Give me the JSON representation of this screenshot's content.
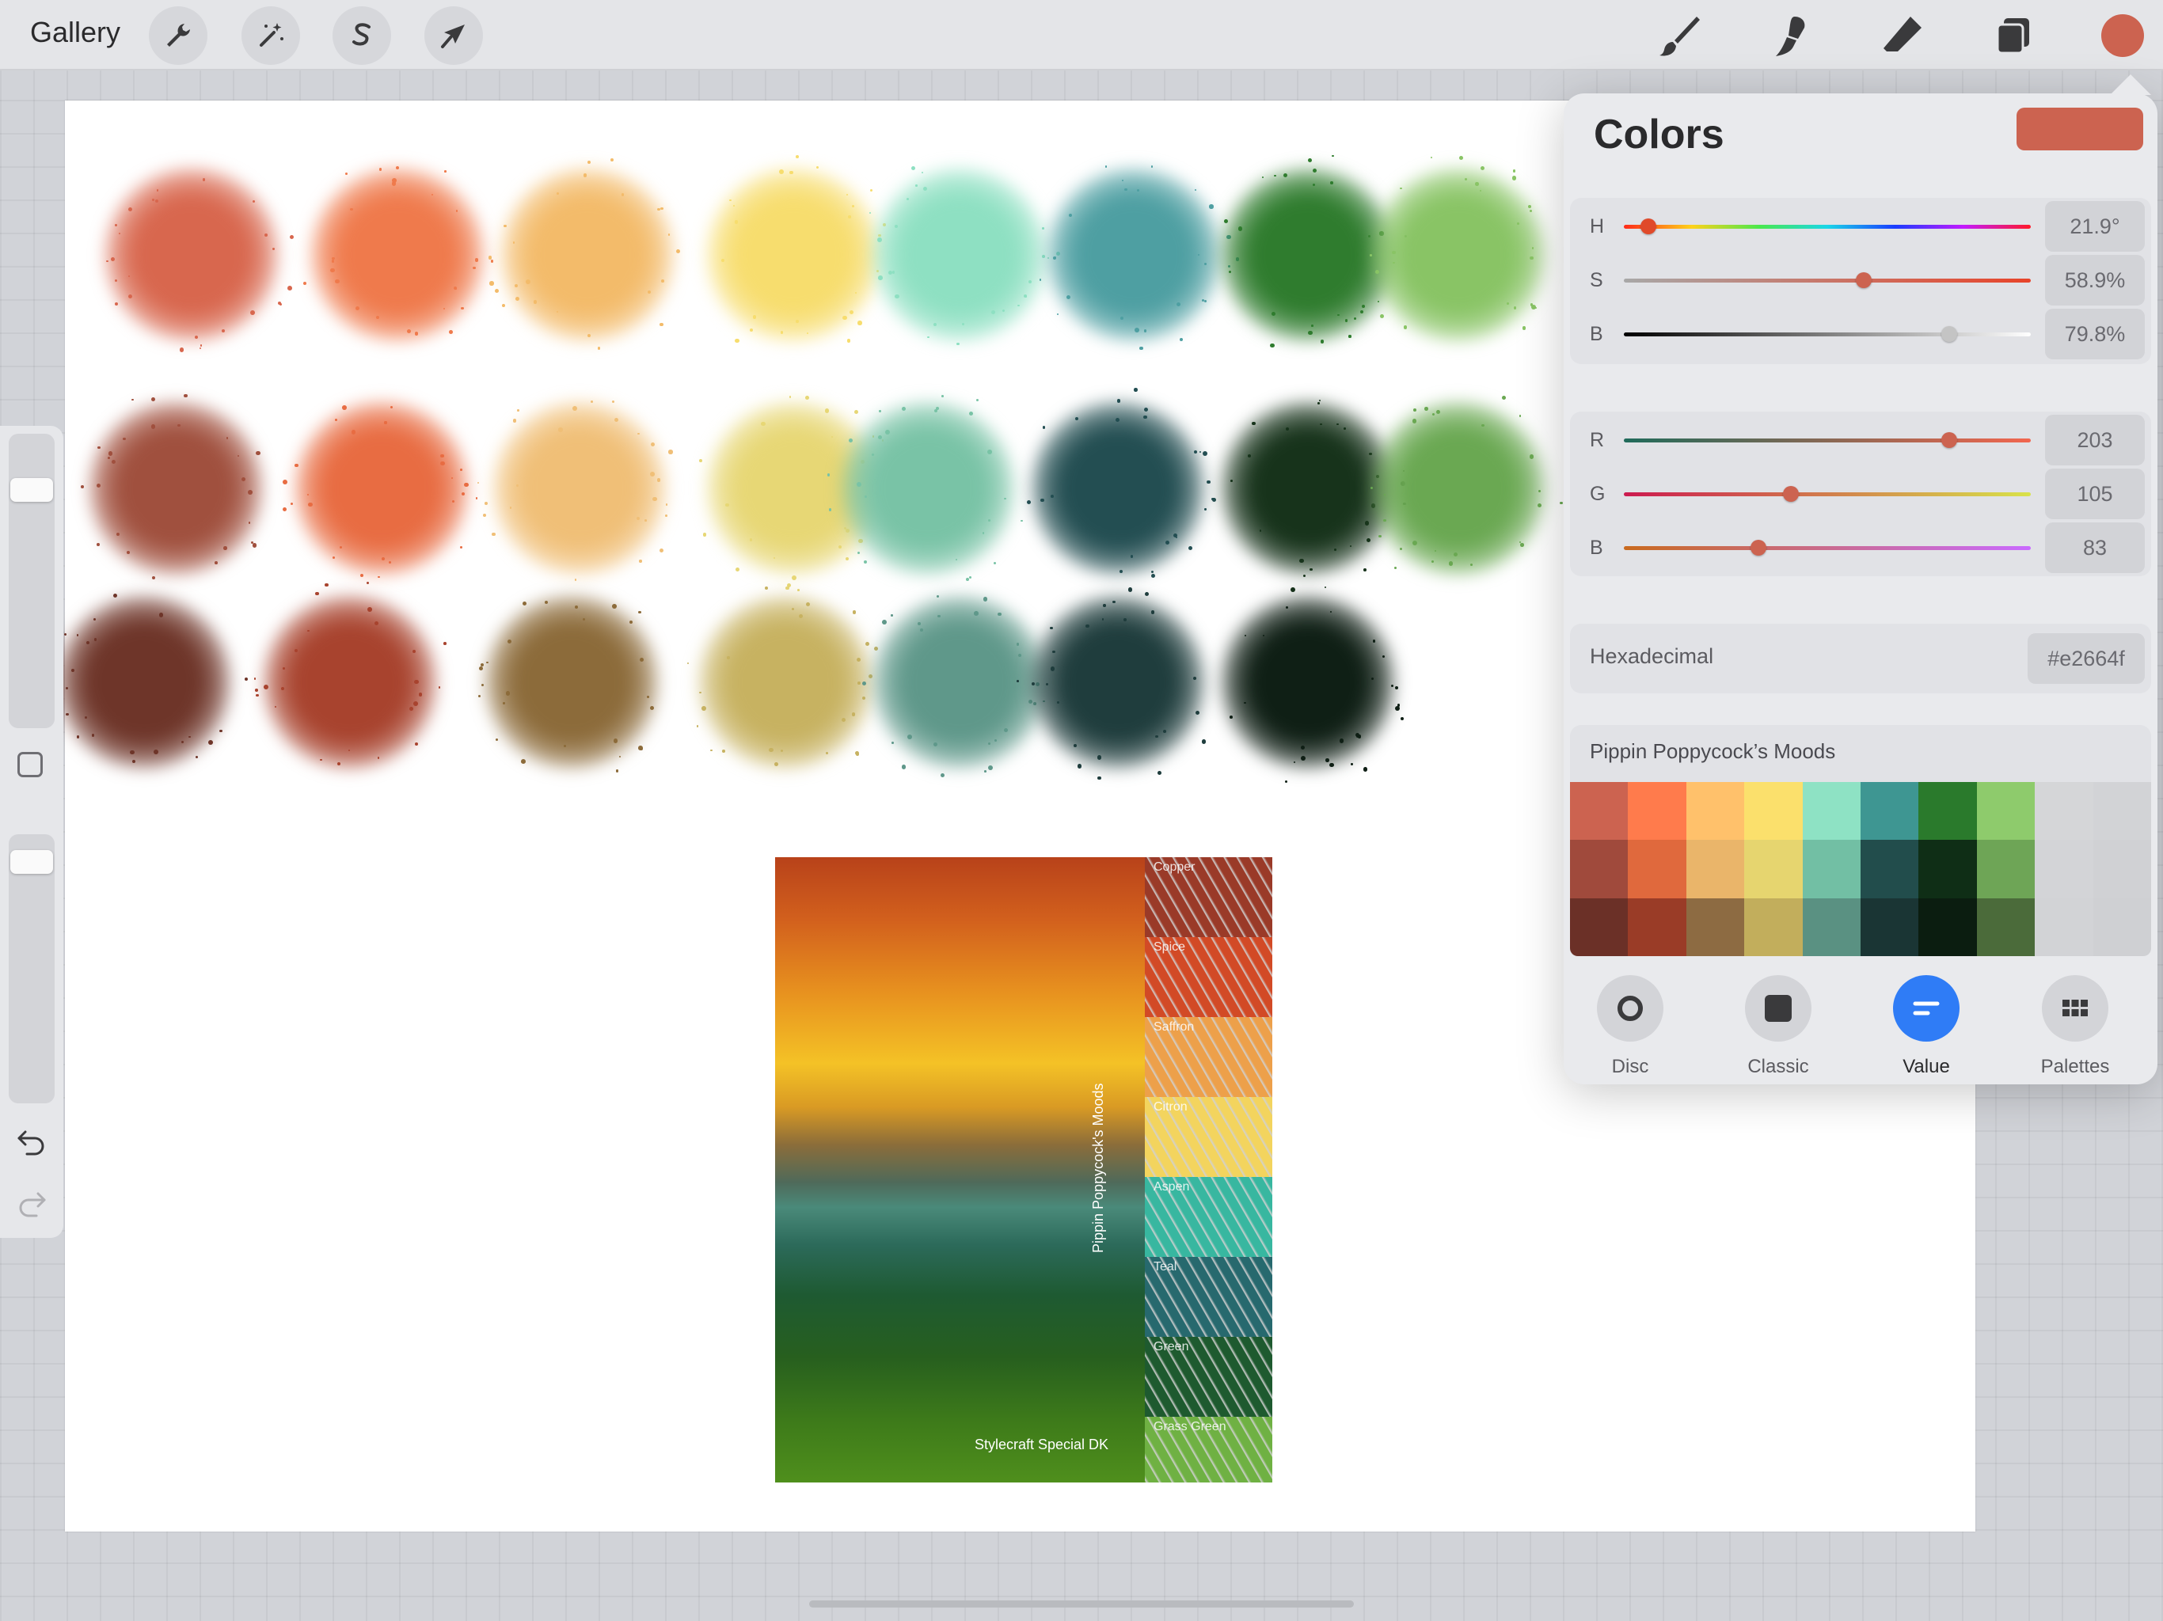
{
  "toolbar": {
    "gallery_label": "Gallery",
    "left_tools": [
      "wrench-icon",
      "magic-wand-icon",
      "selection-s-icon",
      "transform-arrow-icon"
    ],
    "right_tools": [
      "brush-icon",
      "smudge-icon",
      "eraser-icon",
      "layers-icon"
    ],
    "current_color": "#cc6350"
  },
  "canvas": {
    "swatch_rows": [
      [
        "#d8674e",
        "#ef7a4c",
        "#f3bb6a",
        "#f7dd6e",
        "#8ee0c2",
        "#4e9fa2",
        "#2f7c2e",
        "#89c465"
      ],
      [
        "#a0503e",
        "#e86c42",
        "#f0bf77",
        "#e7d775",
        "#79c3a6",
        "#234e52",
        "#17331b",
        "#6aa852"
      ],
      [
        "#6e3529",
        "#a8432e",
        "#8c6b3a",
        "#c7b261",
        "#5f988a",
        "#1f3d3d",
        "#0f1f15"
      ]
    ],
    "reference": {
      "yarn_labels": [
        "Copper",
        "Spice",
        "Saffron",
        "Citron",
        "Aspen",
        "Teal",
        "Green",
        "Grass Green"
      ],
      "yarn_colors": [
        "#9a3a28",
        "#d24a26",
        "#eda04a",
        "#f3d45e",
        "#38b7a0",
        "#27696e",
        "#1e5a2f",
        "#6fb143"
      ],
      "title": "Pippin Poppycock's Moods",
      "brand": "Stylecraft Special DK"
    }
  },
  "colors": {
    "title": "Colors",
    "hsb": [
      {
        "label": "H",
        "value": "21.9°",
        "fraction": 0.06
      },
      {
        "label": "S",
        "value": "58.9%",
        "fraction": 0.59
      },
      {
        "label": "B",
        "value": "79.8%",
        "fraction": 0.8
      }
    ],
    "rgb": [
      {
        "label": "R",
        "value": "203",
        "fraction": 0.8
      },
      {
        "label": "G",
        "value": "105",
        "fraction": 0.41
      },
      {
        "label": "B",
        "value": "83",
        "fraction": 0.33
      }
    ],
    "hex_label": "Hexadecimal",
    "hex_value": "#e2664f",
    "palette_name": "Pippin Poppycock’s Moods",
    "palette": [
      [
        "#cc6350",
        "#ff7b4c",
        "#ffc16b",
        "#fbe06c",
        "#8ee2c4",
        "#3e9692",
        "#2a7a2c",
        "#8ecb6c",
        "#d5d6d8",
        "#d2d3d6"
      ],
      [
        "#a04a3c",
        "#e0693d",
        "#eab56a",
        "#e6d56f",
        "#72bfa4",
        "#224d4c",
        "#0f2e16",
        "#6ea556",
        "#d3d4d7",
        "#d0d1d4"
      ],
      [
        "#6b3027",
        "#9a3c27",
        "#8d6b42",
        "#c2ae5c",
        "#5a9182",
        "#1a3534",
        "#0b1d10",
        "#4b6b3a",
        "#d2d3d6",
        "#cfd0d3"
      ]
    ],
    "modes": [
      {
        "label": "Disc",
        "icon": "disc-icon"
      },
      {
        "label": "Classic",
        "icon": "square-icon"
      },
      {
        "label": "Value",
        "icon": "sliders-icon",
        "active": true
      },
      {
        "label": "Palettes",
        "icon": "grid-icon"
      }
    ]
  }
}
